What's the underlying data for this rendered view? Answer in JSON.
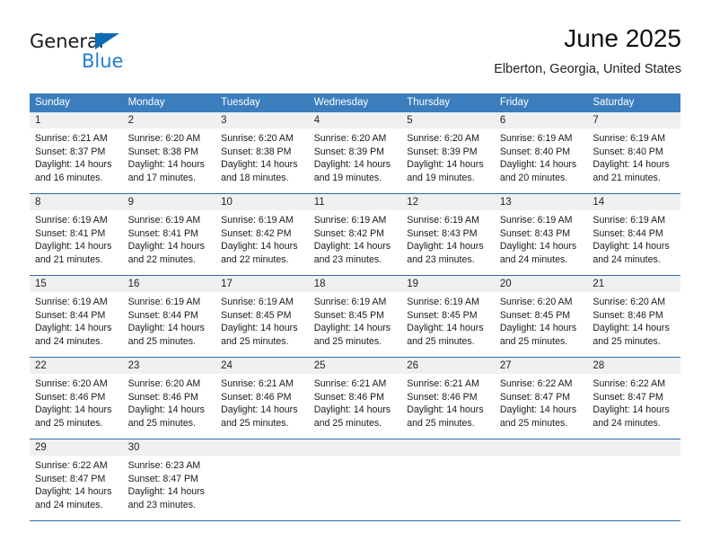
{
  "brand": {
    "name_part1": "General",
    "name_part2": "Blue",
    "triangle_color": "#0b6cb5",
    "blue_color": "#1f7fd0"
  },
  "header": {
    "title": "June 2025",
    "subtitle": "Elberton, Georgia, United States"
  },
  "theme": {
    "header_blue": "#3b7dbd",
    "separator_blue": "#2e6ca4",
    "band_gray": "#f0f0f0"
  },
  "weekdays": [
    "Sunday",
    "Monday",
    "Tuesday",
    "Wednesday",
    "Thursday",
    "Friday",
    "Saturday"
  ],
  "weeks": [
    [
      {
        "day": "1",
        "sunrise": "Sunrise: 6:21 AM",
        "sunset": "Sunset: 8:37 PM",
        "daylight1": "Daylight: 14 hours",
        "daylight2": "and 16 minutes."
      },
      {
        "day": "2",
        "sunrise": "Sunrise: 6:20 AM",
        "sunset": "Sunset: 8:38 PM",
        "daylight1": "Daylight: 14 hours",
        "daylight2": "and 17 minutes."
      },
      {
        "day": "3",
        "sunrise": "Sunrise: 6:20 AM",
        "sunset": "Sunset: 8:38 PM",
        "daylight1": "Daylight: 14 hours",
        "daylight2": "and 18 minutes."
      },
      {
        "day": "4",
        "sunrise": "Sunrise: 6:20 AM",
        "sunset": "Sunset: 8:39 PM",
        "daylight1": "Daylight: 14 hours",
        "daylight2": "and 19 minutes."
      },
      {
        "day": "5",
        "sunrise": "Sunrise: 6:20 AM",
        "sunset": "Sunset: 8:39 PM",
        "daylight1": "Daylight: 14 hours",
        "daylight2": "and 19 minutes."
      },
      {
        "day": "6",
        "sunrise": "Sunrise: 6:19 AM",
        "sunset": "Sunset: 8:40 PM",
        "daylight1": "Daylight: 14 hours",
        "daylight2": "and 20 minutes."
      },
      {
        "day": "7",
        "sunrise": "Sunrise: 6:19 AM",
        "sunset": "Sunset: 8:40 PM",
        "daylight1": "Daylight: 14 hours",
        "daylight2": "and 21 minutes."
      }
    ],
    [
      {
        "day": "8",
        "sunrise": "Sunrise: 6:19 AM",
        "sunset": "Sunset: 8:41 PM",
        "daylight1": "Daylight: 14 hours",
        "daylight2": "and 21 minutes."
      },
      {
        "day": "9",
        "sunrise": "Sunrise: 6:19 AM",
        "sunset": "Sunset: 8:41 PM",
        "daylight1": "Daylight: 14 hours",
        "daylight2": "and 22 minutes."
      },
      {
        "day": "10",
        "sunrise": "Sunrise: 6:19 AM",
        "sunset": "Sunset: 8:42 PM",
        "daylight1": "Daylight: 14 hours",
        "daylight2": "and 22 minutes."
      },
      {
        "day": "11",
        "sunrise": "Sunrise: 6:19 AM",
        "sunset": "Sunset: 8:42 PM",
        "daylight1": "Daylight: 14 hours",
        "daylight2": "and 23 minutes."
      },
      {
        "day": "12",
        "sunrise": "Sunrise: 6:19 AM",
        "sunset": "Sunset: 8:43 PM",
        "daylight1": "Daylight: 14 hours",
        "daylight2": "and 23 minutes."
      },
      {
        "day": "13",
        "sunrise": "Sunrise: 6:19 AM",
        "sunset": "Sunset: 8:43 PM",
        "daylight1": "Daylight: 14 hours",
        "daylight2": "and 24 minutes."
      },
      {
        "day": "14",
        "sunrise": "Sunrise: 6:19 AM",
        "sunset": "Sunset: 8:44 PM",
        "daylight1": "Daylight: 14 hours",
        "daylight2": "and 24 minutes."
      }
    ],
    [
      {
        "day": "15",
        "sunrise": "Sunrise: 6:19 AM",
        "sunset": "Sunset: 8:44 PM",
        "daylight1": "Daylight: 14 hours",
        "daylight2": "and 24 minutes."
      },
      {
        "day": "16",
        "sunrise": "Sunrise: 6:19 AM",
        "sunset": "Sunset: 8:44 PM",
        "daylight1": "Daylight: 14 hours",
        "daylight2": "and 25 minutes."
      },
      {
        "day": "17",
        "sunrise": "Sunrise: 6:19 AM",
        "sunset": "Sunset: 8:45 PM",
        "daylight1": "Daylight: 14 hours",
        "daylight2": "and 25 minutes."
      },
      {
        "day": "18",
        "sunrise": "Sunrise: 6:19 AM",
        "sunset": "Sunset: 8:45 PM",
        "daylight1": "Daylight: 14 hours",
        "daylight2": "and 25 minutes."
      },
      {
        "day": "19",
        "sunrise": "Sunrise: 6:19 AM",
        "sunset": "Sunset: 8:45 PM",
        "daylight1": "Daylight: 14 hours",
        "daylight2": "and 25 minutes."
      },
      {
        "day": "20",
        "sunrise": "Sunrise: 6:20 AM",
        "sunset": "Sunset: 8:45 PM",
        "daylight1": "Daylight: 14 hours",
        "daylight2": "and 25 minutes."
      },
      {
        "day": "21",
        "sunrise": "Sunrise: 6:20 AM",
        "sunset": "Sunset: 8:46 PM",
        "daylight1": "Daylight: 14 hours",
        "daylight2": "and 25 minutes."
      }
    ],
    [
      {
        "day": "22",
        "sunrise": "Sunrise: 6:20 AM",
        "sunset": "Sunset: 8:46 PM",
        "daylight1": "Daylight: 14 hours",
        "daylight2": "and 25 minutes."
      },
      {
        "day": "23",
        "sunrise": "Sunrise: 6:20 AM",
        "sunset": "Sunset: 8:46 PM",
        "daylight1": "Daylight: 14 hours",
        "daylight2": "and 25 minutes."
      },
      {
        "day": "24",
        "sunrise": "Sunrise: 6:21 AM",
        "sunset": "Sunset: 8:46 PM",
        "daylight1": "Daylight: 14 hours",
        "daylight2": "and 25 minutes."
      },
      {
        "day": "25",
        "sunrise": "Sunrise: 6:21 AM",
        "sunset": "Sunset: 8:46 PM",
        "daylight1": "Daylight: 14 hours",
        "daylight2": "and 25 minutes."
      },
      {
        "day": "26",
        "sunrise": "Sunrise: 6:21 AM",
        "sunset": "Sunset: 8:46 PM",
        "daylight1": "Daylight: 14 hours",
        "daylight2": "and 25 minutes."
      },
      {
        "day": "27",
        "sunrise": "Sunrise: 6:22 AM",
        "sunset": "Sunset: 8:47 PM",
        "daylight1": "Daylight: 14 hours",
        "daylight2": "and 25 minutes."
      },
      {
        "day": "28",
        "sunrise": "Sunrise: 6:22 AM",
        "sunset": "Sunset: 8:47 PM",
        "daylight1": "Daylight: 14 hours",
        "daylight2": "and 24 minutes."
      }
    ],
    [
      {
        "day": "29",
        "sunrise": "Sunrise: 6:22 AM",
        "sunset": "Sunset: 8:47 PM",
        "daylight1": "Daylight: 14 hours",
        "daylight2": "and 24 minutes."
      },
      {
        "day": "30",
        "sunrise": "Sunrise: 6:23 AM",
        "sunset": "Sunset: 8:47 PM",
        "daylight1": "Daylight: 14 hours",
        "daylight2": "and 23 minutes."
      },
      {
        "day": "",
        "sunrise": "",
        "sunset": "",
        "daylight1": "",
        "daylight2": ""
      },
      {
        "day": "",
        "sunrise": "",
        "sunset": "",
        "daylight1": "",
        "daylight2": ""
      },
      {
        "day": "",
        "sunrise": "",
        "sunset": "",
        "daylight1": "",
        "daylight2": ""
      },
      {
        "day": "",
        "sunrise": "",
        "sunset": "",
        "daylight1": "",
        "daylight2": ""
      },
      {
        "day": "",
        "sunrise": "",
        "sunset": "",
        "daylight1": "",
        "daylight2": ""
      }
    ]
  ]
}
